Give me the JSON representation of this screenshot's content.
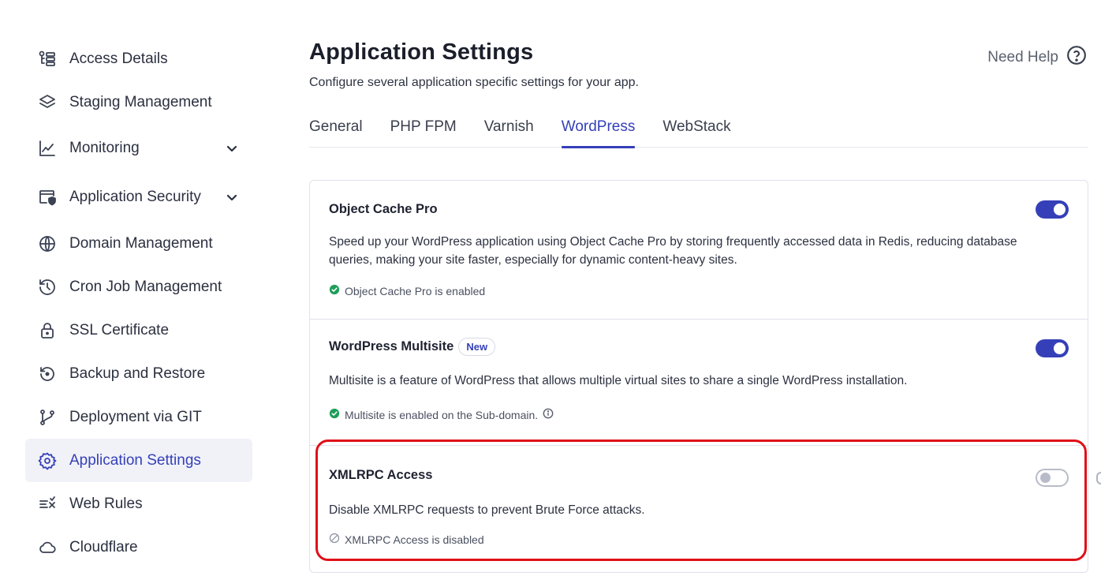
{
  "sidebar": {
    "items": [
      {
        "label": "Access Details",
        "icon": "access-details-icon"
      },
      {
        "label": "Staging Management",
        "icon": "layers-icon"
      },
      {
        "label": "Monitoring",
        "icon": "chart-line-icon",
        "expandable": true
      },
      {
        "label": "Application Security",
        "icon": "shield-window-icon",
        "expandable": true
      },
      {
        "label": "Domain Management",
        "icon": "www-globe-icon"
      },
      {
        "label": "Cron Job Management",
        "icon": "history-clock-icon"
      },
      {
        "label": "SSL Certificate",
        "icon": "lock-icon"
      },
      {
        "label": "Backup and Restore",
        "icon": "backup-restore-icon"
      },
      {
        "label": "Deployment via GIT",
        "icon": "git-branch-icon"
      },
      {
        "label": "Application Settings",
        "icon": "gear-icon",
        "active": true
      },
      {
        "label": "Web Rules",
        "icon": "web-rules-icon"
      },
      {
        "label": "Cloudflare",
        "icon": "cloud-icon"
      }
    ]
  },
  "header": {
    "title": "Application Settings",
    "subtitle": "Configure several application specific settings for your app.",
    "help_label": "Need Help"
  },
  "tabs": [
    {
      "label": "General"
    },
    {
      "label": "PHP FPM"
    },
    {
      "label": "Varnish"
    },
    {
      "label": "WordPress",
      "active": true
    },
    {
      "label": "WebStack"
    }
  ],
  "cards": [
    {
      "title": "Object Cache Pro",
      "description": "Speed up your WordPress application using Object Cache Pro by storing frequently accessed data in Redis, reducing database queries, making your site faster, especially for dynamic content-heavy sites.",
      "status": "Object Cache Pro is enabled",
      "enabled": true
    },
    {
      "title": "WordPress Multisite",
      "badge": "New",
      "description": "Multisite is a feature of WordPress that allows multiple virtual sites to share a single WordPress installation.",
      "status": "Multisite is enabled on the Sub-domain.",
      "enabled": true
    },
    {
      "title": "XMLRPC Access",
      "description": "Disable XMLRPC requests to prevent Brute Force attacks.",
      "status": "XMLRPC Access is disabled",
      "enabled": false
    }
  ],
  "colors": {
    "accent": "#3540b8",
    "success": "#1e9e5a",
    "highlight": "#e00f18",
    "muted": "#b8bcc8"
  }
}
